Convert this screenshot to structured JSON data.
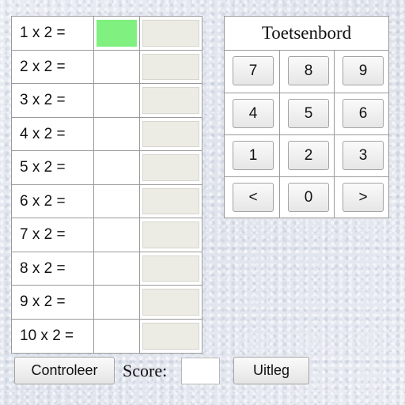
{
  "table": {
    "rows": [
      {
        "question": "1 x 2 =",
        "answer": "",
        "result": "",
        "active": true
      },
      {
        "question": "2 x 2 =",
        "answer": "",
        "result": ""
      },
      {
        "question": "3 x 2 =",
        "answer": "",
        "result": ""
      },
      {
        "question": "4 x 2 =",
        "answer": "",
        "result": ""
      },
      {
        "question": "5 x 2 =",
        "answer": "",
        "result": ""
      },
      {
        "question": "6 x 2 =",
        "answer": "",
        "result": ""
      },
      {
        "question": "7 x 2 =",
        "answer": "",
        "result": ""
      },
      {
        "question": "8 x 2 =",
        "answer": "",
        "result": ""
      },
      {
        "question": "9 x 2 =",
        "answer": "",
        "result": ""
      },
      {
        "question": "10 x 2 =",
        "answer": "",
        "result": ""
      }
    ]
  },
  "keyboard": {
    "title": "Toetsenbord",
    "keys": [
      [
        "7",
        "8",
        "9"
      ],
      [
        "4",
        "5",
        "6"
      ],
      [
        "1",
        "2",
        "3"
      ],
      [
        "<",
        "0",
        ">"
      ]
    ]
  },
  "controls": {
    "check_label": "Controleer",
    "score_label": "Score:",
    "score_value": "",
    "help_label": "Uitleg"
  },
  "colors": {
    "active_answer": "#80f080",
    "result_box": "#ecebe4",
    "background": "#e3e7f0"
  }
}
